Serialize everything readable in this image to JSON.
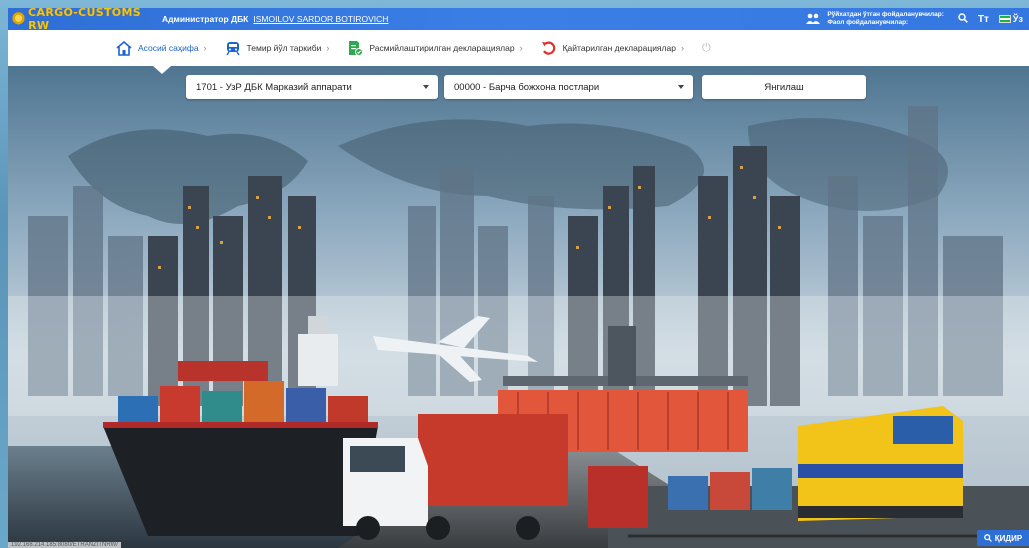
{
  "app": {
    "logo_text": "CARGO-CUSTOMS RW",
    "admin_label": "Администратор ДБК",
    "admin_name": "ISMOILOV SARDOR BOTIROVICH",
    "registered_users": "Рўйхатдан ўтган фойдаланувчилар:",
    "active_users": "Фаол фойдаланувчилар:",
    "font_size_icon": "Tт",
    "lang": "Ўз",
    "brand_color": "#3477e0"
  },
  "nav": {
    "items": [
      {
        "label": "Асосий саҳифа",
        "icon": "home-icon"
      },
      {
        "label": "Темир йўл таркиби",
        "icon": "train-icon"
      },
      {
        "label": "Расмийлаштирилган декларациялар",
        "icon": "document-check-icon"
      },
      {
        "label": "Қайтарилган декларациялар",
        "icon": "undo-icon"
      }
    ],
    "chevron": "›",
    "power": "⏻"
  },
  "filters": {
    "department": "1701 - УзР ДБК Марказий аппарати",
    "post": "00000 - Барча божхона постлари",
    "refresh_label": "Янгилаш"
  },
  "footer": {
    "status_url": "192.168.214.185:8080/ETRANZITNRW/",
    "search_label": "ҚИДИР"
  }
}
